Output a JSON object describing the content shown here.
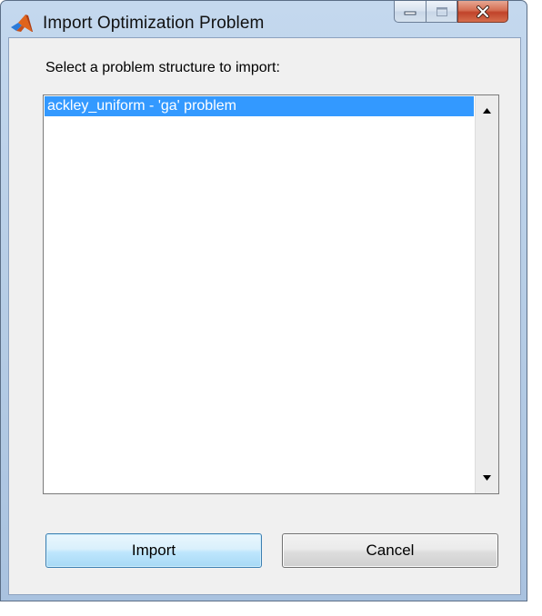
{
  "window": {
    "title": "Import Optimization Problem",
    "app_icon": "matlab-icon",
    "controls": [
      "minimize",
      "maximize",
      "close"
    ]
  },
  "dialog": {
    "prompt": "Select a problem structure to import:",
    "list": {
      "items": [
        "ackley_uniform - 'ga' problem"
      ],
      "selected_index": 0
    },
    "buttons": {
      "import_label": "Import",
      "cancel_label": "Cancel"
    }
  },
  "colors": {
    "selection": "#3399ff",
    "client_background": "#f0f0f0",
    "title_bar": "#b9cfe7",
    "close_button": "#c7472c"
  }
}
